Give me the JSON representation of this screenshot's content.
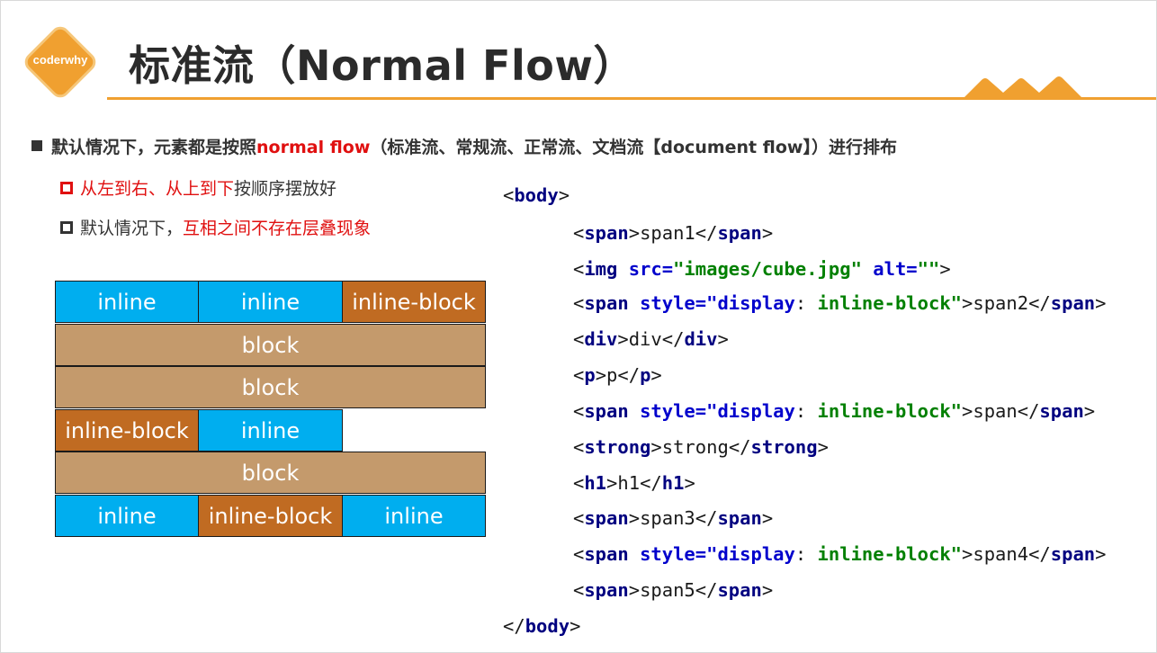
{
  "logo": {
    "text": "coderwhy"
  },
  "title": "标准流（Normal Flow）",
  "colors": {
    "accent": "#f0a030",
    "highlight": "#e01010",
    "inline": "#00aeef",
    "inline_block": "#c06b22",
    "block": "#c49a6c"
  },
  "bullets": {
    "main": {
      "pre": "默认情况下，元素都是按照",
      "highlight": "normal flow",
      "post": "（标准流、常规流、正常流、文档流【document flow】）进行排布"
    },
    "sub1": {
      "red": "从左到右、从上到下",
      "rest": "按顺序摆放好"
    },
    "sub2": {
      "pre": "默认情况下，",
      "red": "互相之间不存在层叠现象"
    }
  },
  "diagram": {
    "row1": [
      "inline",
      "inline",
      "inline-block"
    ],
    "row2": "block",
    "row3": "block",
    "row4": [
      "inline-block",
      "inline"
    ],
    "row5": "block",
    "row6": [
      "inline",
      "inline-block",
      "inline"
    ]
  },
  "code": {
    "lt": "<",
    "gt": ">",
    "lts": "</",
    "eq": "=",
    "colon": ":",
    "body": "body",
    "span": "span",
    "img": "img",
    "div": "div",
    "p": "p",
    "strong": "strong",
    "h1": "h1",
    "src": "src",
    "alt": "alt",
    "style": "style",
    "src_val": "\"images/cube.jpg\"",
    "alt_val": "\"\"",
    "display_q": "\"display",
    "ib_q": " inline-block\"",
    "t_span1": "span1",
    "t_span2": "span2",
    "t_div": "div",
    "t_p": "p",
    "t_span": "span",
    "t_strong": "strong",
    "t_h1": "h1",
    "t_span3": "span3",
    "t_span4": "span4",
    "t_span5": "span5"
  }
}
